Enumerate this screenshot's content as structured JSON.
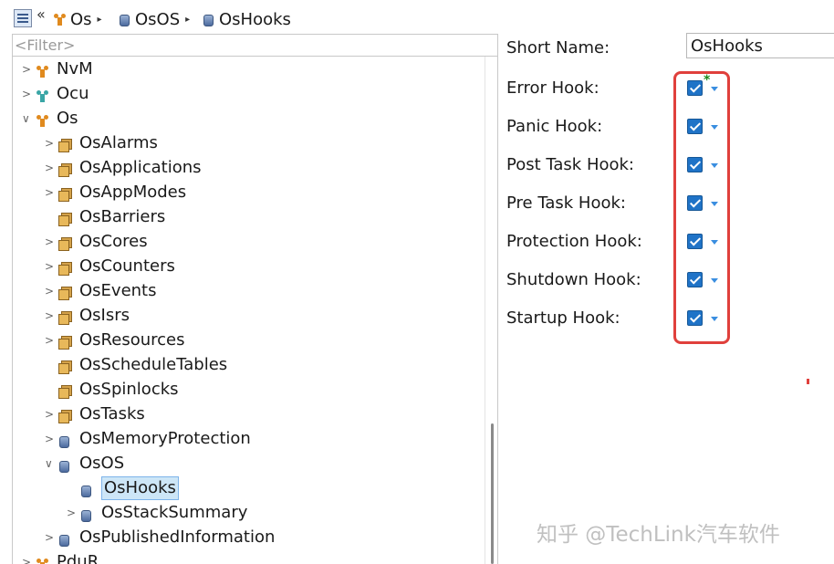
{
  "breadcrumb": {
    "back_glyph": "«",
    "items": [
      {
        "label": "Os",
        "icon": "module-icon"
      },
      {
        "label": "OsOS",
        "icon": "container-object-icon"
      },
      {
        "label": "OsHooks",
        "icon": "container-object-icon"
      }
    ],
    "separator": "▸"
  },
  "tree": {
    "filter_placeholder": "<Filter>",
    "expand_glyph": ">",
    "collapse_glyph": "∨",
    "nodes": [
      {
        "label": "NvM",
        "icon": "module-icon",
        "state": "collapsed"
      },
      {
        "label": "Ocu",
        "icon": "module-icon-teal",
        "state": "collapsed"
      },
      {
        "label": "Os",
        "icon": "module-icon",
        "state": "expanded"
      },
      {
        "label": "OsAlarms",
        "icon": "container-icon",
        "state": "collapsed"
      },
      {
        "label": "OsApplications",
        "icon": "container-icon",
        "state": "collapsed"
      },
      {
        "label": "OsAppModes",
        "icon": "container-icon",
        "state": "collapsed"
      },
      {
        "label": "OsBarriers",
        "icon": "container-icon",
        "state": "leaf"
      },
      {
        "label": "OsCores",
        "icon": "container-icon",
        "state": "collapsed"
      },
      {
        "label": "OsCounters",
        "icon": "container-icon",
        "state": "collapsed"
      },
      {
        "label": "OsEvents",
        "icon": "container-icon",
        "state": "collapsed"
      },
      {
        "label": "OsIsrs",
        "icon": "container-icon",
        "state": "collapsed"
      },
      {
        "label": "OsResources",
        "icon": "container-icon",
        "state": "collapsed"
      },
      {
        "label": "OsScheduleTables",
        "icon": "container-icon",
        "state": "leaf"
      },
      {
        "label": "OsSpinlocks",
        "icon": "container-icon",
        "state": "leaf"
      },
      {
        "label": "OsTasks",
        "icon": "container-icon",
        "state": "collapsed"
      },
      {
        "label": "OsMemoryProtection",
        "icon": "object-icon",
        "state": "collapsed"
      },
      {
        "label": "OsOS",
        "icon": "object-icon",
        "state": "expanded"
      },
      {
        "label": "OsHooks",
        "icon": "object-icon",
        "state": "leaf",
        "selected": true
      },
      {
        "label": "OsStackSummary",
        "icon": "object-icon",
        "state": "collapsed"
      },
      {
        "label": "OsPublishedInformation",
        "icon": "object-icon",
        "state": "collapsed"
      },
      {
        "label": "PduR",
        "icon": "module-icon",
        "state": "collapsed"
      }
    ]
  },
  "properties": {
    "short_name_label": "Short Name:",
    "short_name_value": "OsHooks",
    "modified_marker": "*",
    "hooks": [
      {
        "label": "Error Hook:",
        "checked": true
      },
      {
        "label": "Panic Hook:",
        "checked": true
      },
      {
        "label": "Post Task Hook:",
        "checked": true
      },
      {
        "label": "Pre Task Hook:",
        "checked": true
      },
      {
        "label": "Protection Hook:",
        "checked": true
      },
      {
        "label": "Shutdown Hook:",
        "checked": true
      },
      {
        "label": "Startup Hook:",
        "checked": true
      }
    ]
  },
  "watermark": "知乎 @TechLink汽车软件",
  "colors": {
    "highlight_box": "#e0403c",
    "checkbox": "#1f73c7",
    "selection_bg": "#cde6f7",
    "modified_marker": "#1c8a1c"
  }
}
